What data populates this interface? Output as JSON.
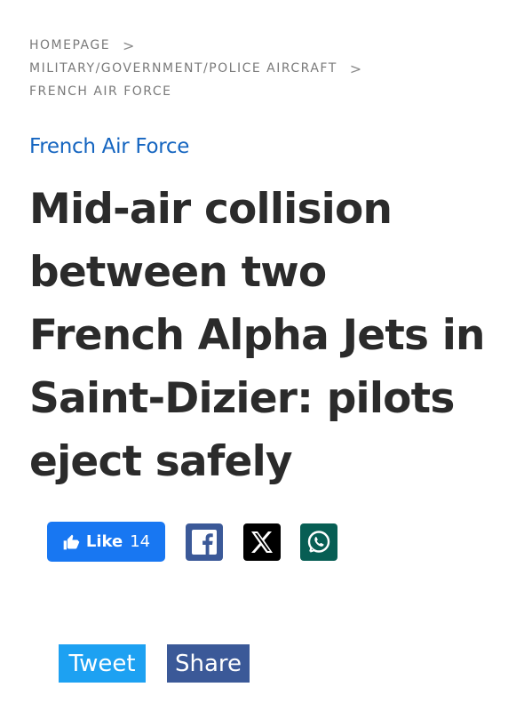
{
  "breadcrumb": {
    "items": [
      {
        "label": "HOMEPAGE",
        "separator": ">"
      },
      {
        "label": "MILITARY/GOVERNMENT/POLICE AIRCRAFT",
        "separator": ">"
      },
      {
        "label": "FRENCH AIR FORCE",
        "separator": ""
      }
    ]
  },
  "article": {
    "category": "French Air Force",
    "title": "Mid-air collision between two French Alpha Jets in Saint-Dizier: pilots eject safely"
  },
  "social": {
    "like_label": "Like",
    "like_count": "14",
    "facebook_icon": "facebook-icon",
    "x_icon": "x-icon",
    "whatsapp_icon": "whatsapp-icon",
    "tweet_label": "Tweet",
    "share_label": "Share"
  },
  "colors": {
    "category": "#1565c0",
    "like": "#1877f2",
    "facebook": "#3b5998",
    "x": "#000000",
    "whatsapp": "#075e54",
    "tweet": "#1da1f2",
    "share": "#3b5998"
  }
}
